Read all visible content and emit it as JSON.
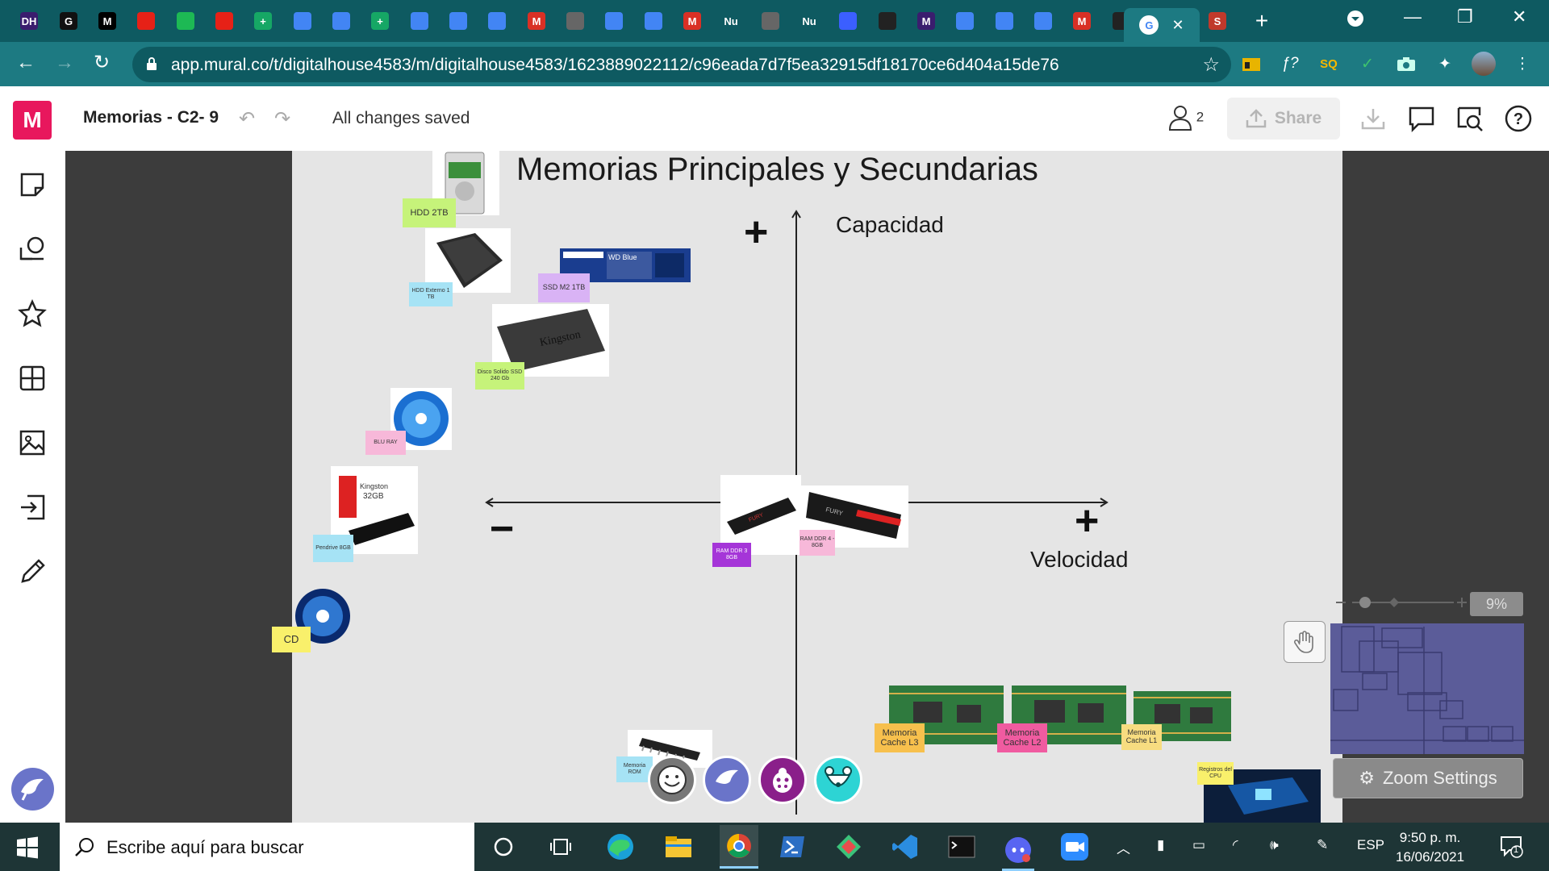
{
  "browser": {
    "tabs": [
      {
        "icon": "digitalhouse-icon",
        "label": "DH",
        "color": "#3a1d6e"
      },
      {
        "icon": "grammarly-icon",
        "label": "G",
        "color": "#111"
      },
      {
        "icon": "medium-icon",
        "label": "M",
        "color": "#000"
      },
      {
        "icon": "youtube-icon",
        "label": "",
        "color": "#e62117"
      },
      {
        "icon": "spotify-icon",
        "label": "",
        "color": "#1db954"
      },
      {
        "icon": "youtube-icon",
        "label": "",
        "color": "#e62117"
      },
      {
        "icon": "sheets-icon",
        "label": "+",
        "color": "#16a765"
      },
      {
        "icon": "docs-icon",
        "label": "",
        "color": "#4285f4"
      },
      {
        "icon": "docs-icon",
        "label": "",
        "color": "#4285f4"
      },
      {
        "icon": "sheets-icon",
        "label": "+",
        "color": "#16a765"
      },
      {
        "icon": "docs-icon",
        "label": "",
        "color": "#4285f4"
      },
      {
        "icon": "docs-icon",
        "label": "",
        "color": "#4285f4"
      },
      {
        "icon": "docs-icon",
        "label": "",
        "color": "#4285f4"
      },
      {
        "icon": "gmail-icon",
        "label": "M",
        "color": "#d93025"
      },
      {
        "icon": "globe-icon",
        "label": "",
        "color": "#666"
      },
      {
        "icon": "docs-icon",
        "label": "",
        "color": "#4285f4"
      },
      {
        "icon": "docs-icon",
        "label": "",
        "color": "#4285f4"
      },
      {
        "icon": "gmail-icon",
        "label": "M",
        "color": "#d93025"
      },
      {
        "icon": "nubank-icon",
        "label": "Nu",
        "color": "#0e5a61"
      },
      {
        "icon": "globe-icon",
        "label": "",
        "color": "#666"
      },
      {
        "icon": "nubank-icon",
        "label": "Nu",
        "color": "#0e5a61"
      },
      {
        "icon": "flag-icon",
        "label": "",
        "color": "#3b5fff"
      },
      {
        "icon": "github-icon",
        "label": "",
        "color": "#222"
      },
      {
        "icon": "mural-icon",
        "label": "M",
        "color": "#3a1d6e"
      },
      {
        "icon": "docs-icon",
        "label": "",
        "color": "#4285f4"
      },
      {
        "icon": "docs-icon",
        "label": "",
        "color": "#4285f4"
      },
      {
        "icon": "docs-icon",
        "label": "",
        "color": "#4285f4"
      },
      {
        "icon": "gmail-icon",
        "label": "M",
        "color": "#d93025"
      },
      {
        "icon": "github-icon",
        "label": "",
        "color": "#222"
      },
      {
        "icon": "google-icon",
        "label": "G",
        "color": "#fff"
      }
    ],
    "active_tab_close": "✕",
    "extra_tab": {
      "icon": "scribd-icon",
      "label": "S",
      "color": "#c0392b"
    },
    "new_tab": "+",
    "url": "app.mural.co/t/digitalhouse4583/m/digitalhouse4583/1623889022112/c96eada7d7f5ea32915df18170ce6d404a15de76",
    "extensions": [
      "ƒ?",
      "SQ"
    ]
  },
  "mural": {
    "logo": "M",
    "title": "Memorias - C2- 9",
    "status": "All changes saved",
    "user_count": "2",
    "share_label": "Share"
  },
  "board": {
    "title": "Memorias Principales y Secundarias",
    "y_axis_label": "Capacidad",
    "x_axis_label": "Velocidad",
    "plus_top": "+",
    "plus_right": "+",
    "minus_left": "−",
    "notes": {
      "hdd2tb": "HDD 2TB",
      "hdd_ext": "HDD Externo 1 TB",
      "ssd_m2": "SSD M2 1TB",
      "ssd_disk": "Disco Solido SSD 240 Gb",
      "bluray": "BLU RAY",
      "pendrive": "Pendrive 8GB",
      "cd": "CD",
      "ram3": "RAM DDR 3 8GB",
      "ram4": "RAM DDR 4 - 8GB",
      "rom": "Memoria ROM",
      "cache3": "Memoria Cache L3",
      "cache2": "Memoria Cache L2",
      "cache1": "Memoria Cache L1",
      "registers": "Registros del CPU"
    },
    "image_labels": {
      "wd_blue": "WD Blue",
      "kingston": "Kingston",
      "fury": "FURY",
      "pendrive_brand": "Kingston",
      "pendrive_size": "32GB"
    }
  },
  "zoom": {
    "percent": "9%",
    "settings_label": "Zoom Settings"
  },
  "taskbar": {
    "search_placeholder": "Escribe aquí para buscar",
    "language": "ESP",
    "time": "9:50 p. m.",
    "date": "16/06/2021",
    "notifications": "1"
  },
  "colors": {
    "browser_dark": "#0e5a61",
    "browser_light": "#1d7a82",
    "mural_pink": "#e8175d",
    "board": "#e5e5e5",
    "canvas": "#3c3c3c",
    "note_green": "#c6f37a",
    "note_blue": "#a6e3f5",
    "note_purple": "#d9b3f5",
    "note_pink": "#f7b8d9",
    "note_yellow": "#f9f06b",
    "note_violet": "#a535d8",
    "note_orange": "#f7c04d",
    "note_magenta": "#f05ba0"
  }
}
